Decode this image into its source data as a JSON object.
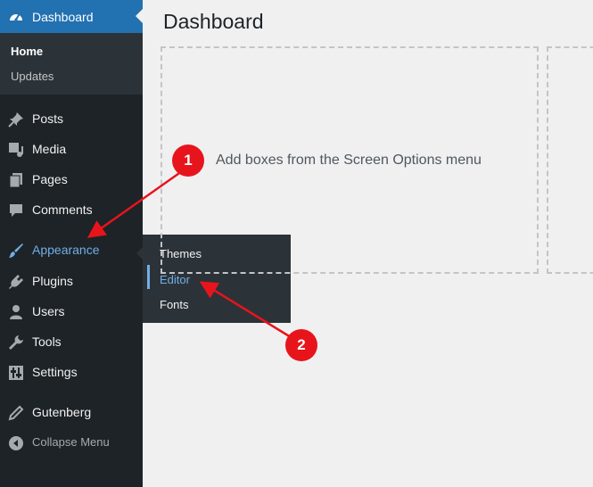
{
  "sidebar": {
    "active": {
      "label": "Dashboard",
      "icon": "dashboard-icon"
    },
    "submenu": [
      {
        "label": "Home",
        "current": true
      },
      {
        "label": "Updates",
        "current": false
      }
    ],
    "items": [
      {
        "label": "Posts",
        "icon": "pin-icon"
      },
      {
        "label": "Media",
        "icon": "media-icon"
      },
      {
        "label": "Pages",
        "icon": "pages-icon"
      },
      {
        "label": "Comments",
        "icon": "comment-icon"
      },
      {
        "label": "Appearance",
        "icon": "brush-icon"
      },
      {
        "label": "Plugins",
        "icon": "plugin-icon"
      },
      {
        "label": "Users",
        "icon": "user-icon"
      },
      {
        "label": "Tools",
        "icon": "wrench-icon"
      },
      {
        "label": "Settings",
        "icon": "settings-icon"
      },
      {
        "label": "Gutenberg",
        "icon": "pencil-icon"
      },
      {
        "label": "Collapse Menu",
        "icon": "collapse-icon"
      }
    ]
  },
  "flyout": {
    "items": [
      "Themes",
      "Editor",
      "Fonts"
    ]
  },
  "main": {
    "title": "Dashboard",
    "empty_box_text": "Add boxes from the Screen Options menu"
  },
  "annotations": {
    "step1": "1",
    "step2": "2"
  },
  "colors": {
    "sidebar_bg": "#1d2327",
    "active_bg": "#2271b1",
    "highlight": "#72aee6",
    "annotation_red": "#e8141c"
  }
}
